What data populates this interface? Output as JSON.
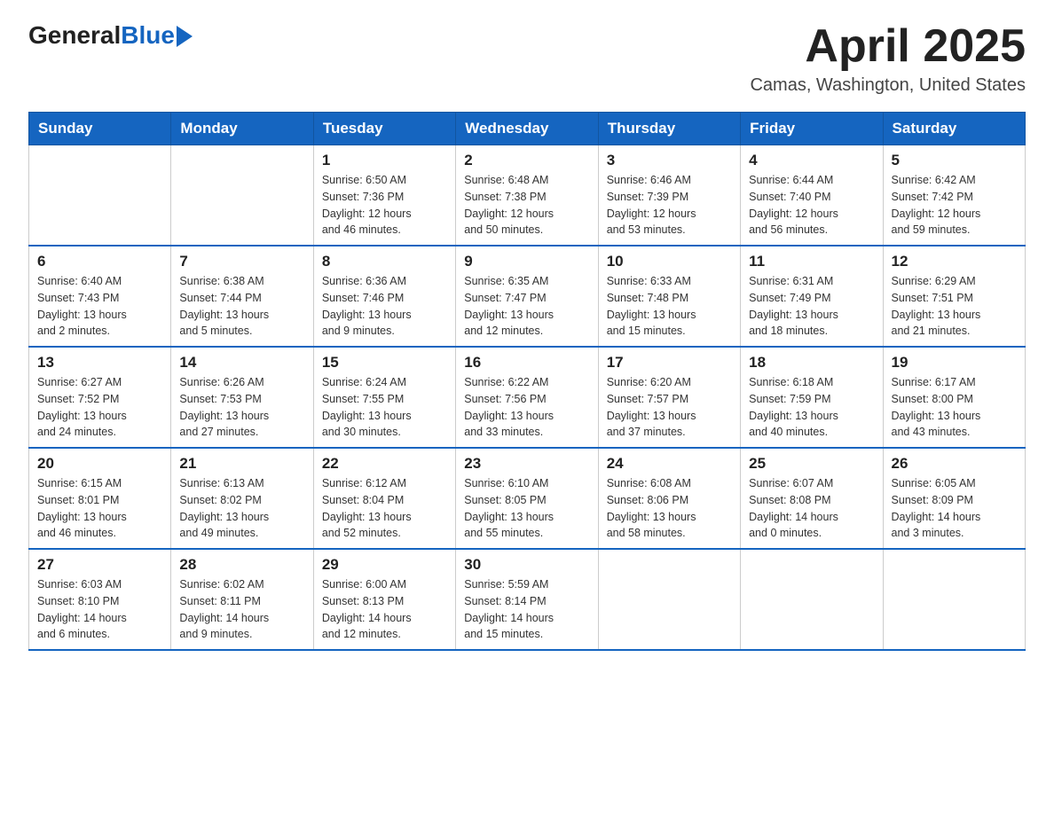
{
  "header": {
    "logo_general": "General",
    "logo_blue": "Blue",
    "title": "April 2025",
    "subtitle": "Camas, Washington, United States"
  },
  "calendar": {
    "days_of_week": [
      "Sunday",
      "Monday",
      "Tuesday",
      "Wednesday",
      "Thursday",
      "Friday",
      "Saturday"
    ],
    "weeks": [
      [
        {
          "day": "",
          "info": ""
        },
        {
          "day": "",
          "info": ""
        },
        {
          "day": "1",
          "info": "Sunrise: 6:50 AM\nSunset: 7:36 PM\nDaylight: 12 hours\nand 46 minutes."
        },
        {
          "day": "2",
          "info": "Sunrise: 6:48 AM\nSunset: 7:38 PM\nDaylight: 12 hours\nand 50 minutes."
        },
        {
          "day": "3",
          "info": "Sunrise: 6:46 AM\nSunset: 7:39 PM\nDaylight: 12 hours\nand 53 minutes."
        },
        {
          "day": "4",
          "info": "Sunrise: 6:44 AM\nSunset: 7:40 PM\nDaylight: 12 hours\nand 56 minutes."
        },
        {
          "day": "5",
          "info": "Sunrise: 6:42 AM\nSunset: 7:42 PM\nDaylight: 12 hours\nand 59 minutes."
        }
      ],
      [
        {
          "day": "6",
          "info": "Sunrise: 6:40 AM\nSunset: 7:43 PM\nDaylight: 13 hours\nand 2 minutes."
        },
        {
          "day": "7",
          "info": "Sunrise: 6:38 AM\nSunset: 7:44 PM\nDaylight: 13 hours\nand 5 minutes."
        },
        {
          "day": "8",
          "info": "Sunrise: 6:36 AM\nSunset: 7:46 PM\nDaylight: 13 hours\nand 9 minutes."
        },
        {
          "day": "9",
          "info": "Sunrise: 6:35 AM\nSunset: 7:47 PM\nDaylight: 13 hours\nand 12 minutes."
        },
        {
          "day": "10",
          "info": "Sunrise: 6:33 AM\nSunset: 7:48 PM\nDaylight: 13 hours\nand 15 minutes."
        },
        {
          "day": "11",
          "info": "Sunrise: 6:31 AM\nSunset: 7:49 PM\nDaylight: 13 hours\nand 18 minutes."
        },
        {
          "day": "12",
          "info": "Sunrise: 6:29 AM\nSunset: 7:51 PM\nDaylight: 13 hours\nand 21 minutes."
        }
      ],
      [
        {
          "day": "13",
          "info": "Sunrise: 6:27 AM\nSunset: 7:52 PM\nDaylight: 13 hours\nand 24 minutes."
        },
        {
          "day": "14",
          "info": "Sunrise: 6:26 AM\nSunset: 7:53 PM\nDaylight: 13 hours\nand 27 minutes."
        },
        {
          "day": "15",
          "info": "Sunrise: 6:24 AM\nSunset: 7:55 PM\nDaylight: 13 hours\nand 30 minutes."
        },
        {
          "day": "16",
          "info": "Sunrise: 6:22 AM\nSunset: 7:56 PM\nDaylight: 13 hours\nand 33 minutes."
        },
        {
          "day": "17",
          "info": "Sunrise: 6:20 AM\nSunset: 7:57 PM\nDaylight: 13 hours\nand 37 minutes."
        },
        {
          "day": "18",
          "info": "Sunrise: 6:18 AM\nSunset: 7:59 PM\nDaylight: 13 hours\nand 40 minutes."
        },
        {
          "day": "19",
          "info": "Sunrise: 6:17 AM\nSunset: 8:00 PM\nDaylight: 13 hours\nand 43 minutes."
        }
      ],
      [
        {
          "day": "20",
          "info": "Sunrise: 6:15 AM\nSunset: 8:01 PM\nDaylight: 13 hours\nand 46 minutes."
        },
        {
          "day": "21",
          "info": "Sunrise: 6:13 AM\nSunset: 8:02 PM\nDaylight: 13 hours\nand 49 minutes."
        },
        {
          "day": "22",
          "info": "Sunrise: 6:12 AM\nSunset: 8:04 PM\nDaylight: 13 hours\nand 52 minutes."
        },
        {
          "day": "23",
          "info": "Sunrise: 6:10 AM\nSunset: 8:05 PM\nDaylight: 13 hours\nand 55 minutes."
        },
        {
          "day": "24",
          "info": "Sunrise: 6:08 AM\nSunset: 8:06 PM\nDaylight: 13 hours\nand 58 minutes."
        },
        {
          "day": "25",
          "info": "Sunrise: 6:07 AM\nSunset: 8:08 PM\nDaylight: 14 hours\nand 0 minutes."
        },
        {
          "day": "26",
          "info": "Sunrise: 6:05 AM\nSunset: 8:09 PM\nDaylight: 14 hours\nand 3 minutes."
        }
      ],
      [
        {
          "day": "27",
          "info": "Sunrise: 6:03 AM\nSunset: 8:10 PM\nDaylight: 14 hours\nand 6 minutes."
        },
        {
          "day": "28",
          "info": "Sunrise: 6:02 AM\nSunset: 8:11 PM\nDaylight: 14 hours\nand 9 minutes."
        },
        {
          "day": "29",
          "info": "Sunrise: 6:00 AM\nSunset: 8:13 PM\nDaylight: 14 hours\nand 12 minutes."
        },
        {
          "day": "30",
          "info": "Sunrise: 5:59 AM\nSunset: 8:14 PM\nDaylight: 14 hours\nand 15 minutes."
        },
        {
          "day": "",
          "info": ""
        },
        {
          "day": "",
          "info": ""
        },
        {
          "day": "",
          "info": ""
        }
      ]
    ]
  }
}
